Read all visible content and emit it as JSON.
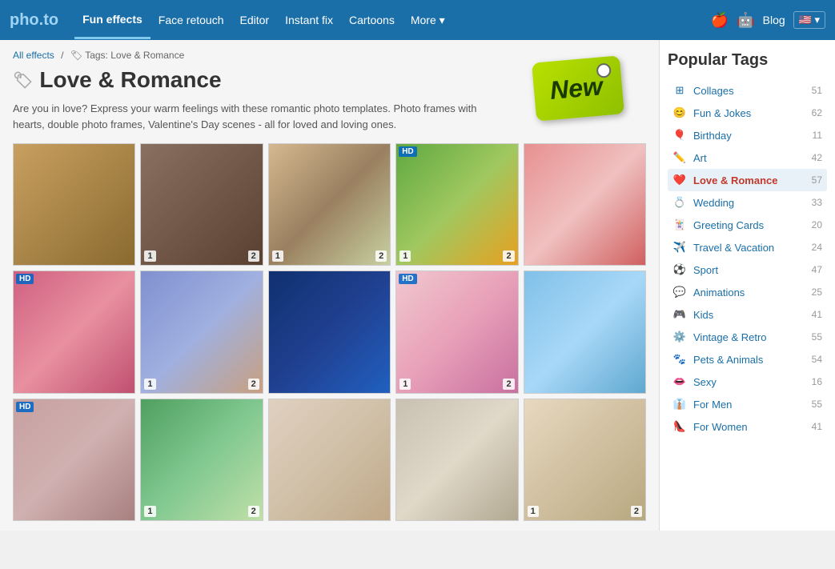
{
  "header": {
    "logo": "pho.to",
    "logo_part1": "pho",
    "logo_sep": ".",
    "logo_part2": "to",
    "nav": [
      {
        "label": "Fun effects",
        "active": true
      },
      {
        "label": "Face retouch",
        "active": false
      },
      {
        "label": "Editor",
        "active": false
      },
      {
        "label": "Instant fix",
        "active": false
      },
      {
        "label": "Cartoons",
        "active": false
      },
      {
        "label": "More ▾",
        "active": false
      }
    ],
    "blog_label": "Blog",
    "flag_label": "🇺🇸 ▾"
  },
  "breadcrumb": {
    "all_effects": "All effects",
    "separator": "/",
    "current": "Tags: Love & Romance"
  },
  "page": {
    "title": "Love & Romance",
    "description": "Are you in love? Express your warm feelings with these romantic photo templates. Photo frames with hearts, double photo frames, Valentine's Day scenes - all for loved and loving ones.",
    "new_badge": "New"
  },
  "popular_tags": {
    "title": "Popular Tags",
    "items": [
      {
        "label": "Collages",
        "count": "51",
        "icon": "⊞",
        "active": false
      },
      {
        "label": "Fun & Jokes",
        "count": "62",
        "icon": "😊",
        "active": false
      },
      {
        "label": "Birthday",
        "count": "11",
        "icon": "🎈",
        "active": false
      },
      {
        "label": "Art",
        "count": "42",
        "icon": "✏️",
        "active": false
      },
      {
        "label": "Love & Romance",
        "count": "57",
        "icon": "❤️",
        "active": true
      },
      {
        "label": "Wedding",
        "count": "33",
        "icon": "💍",
        "active": false
      },
      {
        "label": "Greeting Cards",
        "count": "20",
        "icon": "🃏",
        "active": false
      },
      {
        "label": "Travel & Vacation",
        "count": "24",
        "icon": "✈️",
        "active": false
      },
      {
        "label": "Sport",
        "count": "47",
        "icon": "⚙️",
        "active": false
      },
      {
        "label": "Animations",
        "count": "25",
        "icon": "💬",
        "active": false
      },
      {
        "label": "Kids",
        "count": "41",
        "icon": "🎮",
        "active": false
      },
      {
        "label": "Vintage & Retro",
        "count": "55",
        "icon": "⚙️",
        "active": false
      },
      {
        "label": "Pets & Animals",
        "count": "54",
        "icon": "🐾",
        "active": false
      },
      {
        "label": "Sexy",
        "count": "16",
        "icon": "👄",
        "active": false
      },
      {
        "label": "For Men",
        "count": "55",
        "icon": "👔",
        "active": false
      },
      {
        "label": "For Women",
        "count": "41",
        "icon": "👠",
        "active": false
      }
    ]
  },
  "photos": [
    {
      "badge": "",
      "num1": "",
      "num2": "",
      "style": "ph1"
    },
    {
      "badge": "",
      "num1": "1",
      "num2": "2",
      "style": "ph2"
    },
    {
      "badge": "",
      "num1": "1",
      "num2": "2",
      "style": "ph3"
    },
    {
      "badge": "HD",
      "num1": "1",
      "num2": "2",
      "style": "ph4"
    },
    {
      "badge": "",
      "num1": "",
      "num2": "",
      "style": "ph5"
    },
    {
      "badge": "HD",
      "num1": "",
      "num2": "",
      "style": "ph6"
    },
    {
      "badge": "",
      "num1": "1",
      "num2": "2",
      "style": "ph7"
    },
    {
      "badge": "",
      "num1": "",
      "num2": "",
      "style": "ph8"
    },
    {
      "badge": "HD",
      "num1": "1",
      "num2": "2",
      "style": "ph9"
    },
    {
      "badge": "",
      "num1": "",
      "num2": "",
      "style": "ph10"
    },
    {
      "badge": "HD",
      "num1": "",
      "num2": "",
      "style": "ph11"
    },
    {
      "badge": "",
      "num1": "1",
      "num2": "2",
      "style": "ph12"
    },
    {
      "badge": "",
      "num1": "",
      "num2": "",
      "style": "ph13"
    },
    {
      "badge": "",
      "num1": "",
      "num2": "",
      "style": "ph14"
    },
    {
      "badge": "",
      "num1": "1",
      "num2": "2",
      "style": "ph15"
    }
  ]
}
